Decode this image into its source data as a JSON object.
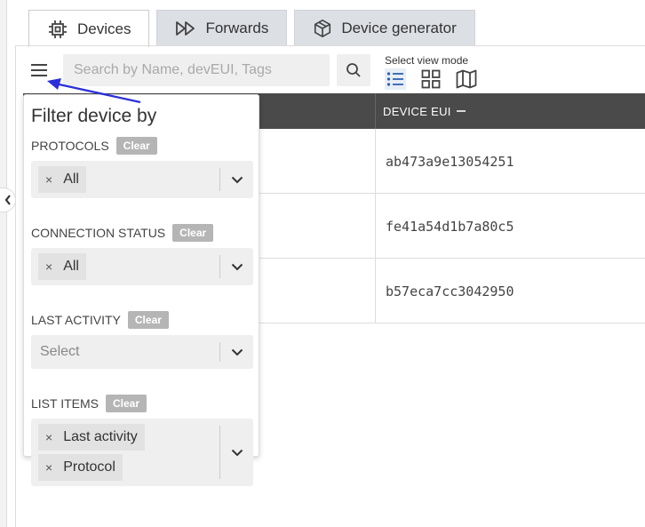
{
  "tabs": [
    {
      "label": "Devices",
      "icon": "chip-icon",
      "active": true
    },
    {
      "label": "Forwards",
      "icon": "fast-forward-icon",
      "active": false
    },
    {
      "label": "Device generator",
      "icon": "box-icon",
      "active": false
    }
  ],
  "search": {
    "placeholder": "Search by Name, devEUI, Tags"
  },
  "view_mode": {
    "label": "Select view mode",
    "selected": "list"
  },
  "table": {
    "headers": {
      "device_eui": "DEVICE EUI"
    },
    "rows": [
      {
        "device_eui": "ab473a9e13054251"
      },
      {
        "device_eui": "fe41a54d1b7a80c5"
      },
      {
        "device_eui": "b57eca7cc3042950"
      }
    ]
  },
  "filter": {
    "title": "Filter device by",
    "clear_label": "Clear",
    "sections": [
      {
        "label": "PROTOCOLS",
        "values": [
          "All"
        ]
      },
      {
        "label": "CONNECTION STATUS",
        "values": [
          "All"
        ]
      },
      {
        "label": "LAST ACTIVITY",
        "placeholder": "Select"
      },
      {
        "label": "LIST ITEMS",
        "values": [
          "Last activity",
          "Protocol"
        ]
      }
    ]
  },
  "colors": {
    "header_bg": "#4a4a4a",
    "annotation_arrow": "#2b2fd9",
    "clear_bg": "#b5b5b5"
  }
}
